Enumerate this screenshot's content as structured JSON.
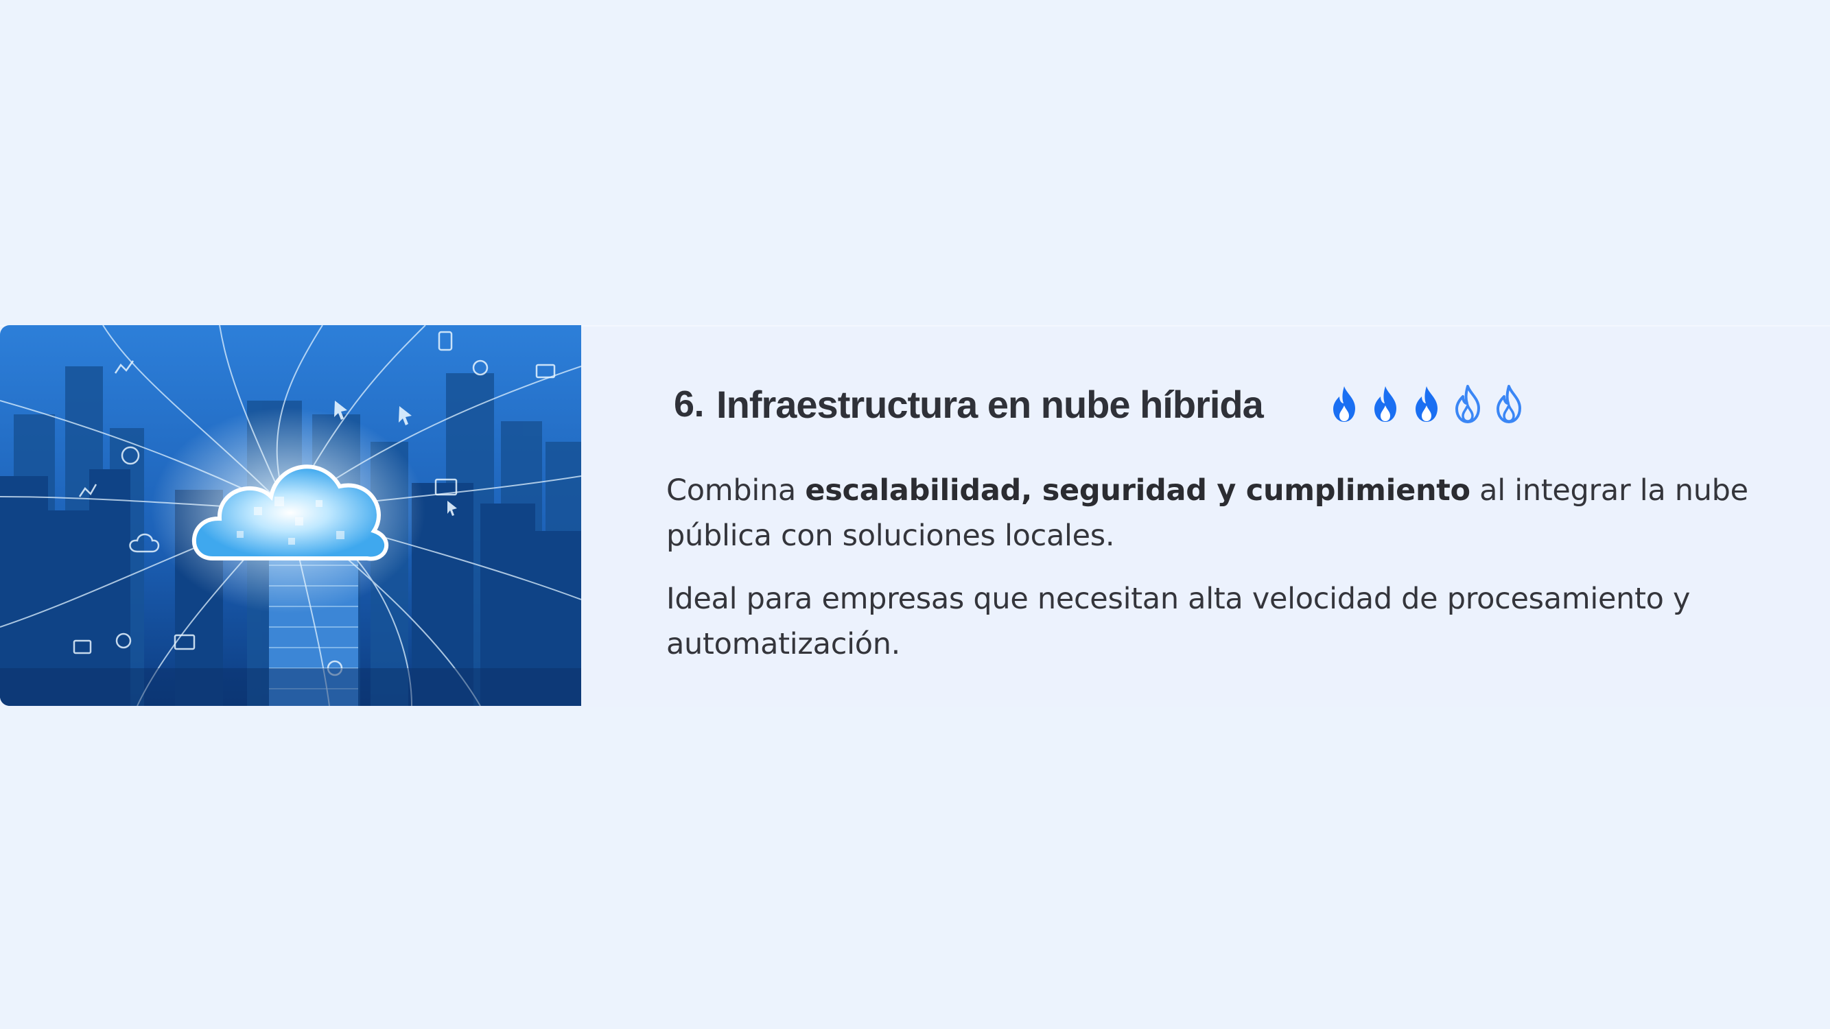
{
  "section": {
    "number": "6.",
    "title": "Infraestructura en nube híbrida",
    "rating": {
      "icon": "flame-icon",
      "value": 3,
      "max": 5,
      "filled_color": "#1a6ff2",
      "empty_color": "#3a86f5"
    }
  },
  "paragraph1": {
    "before": "Combina ",
    "bold": "escalabilidad, seguridad y cumplimiento",
    "after": " al integrar la nube pública con soluciones locales."
  },
  "paragraph2": {
    "text": "Ideal para empresas que necesitan alta velocidad de procesamiento y automatización."
  },
  "colors": {
    "background": "#ecf3fd",
    "title": "#2f3138",
    "body_text": "#34353b",
    "accent": "#1a6ff2"
  }
}
